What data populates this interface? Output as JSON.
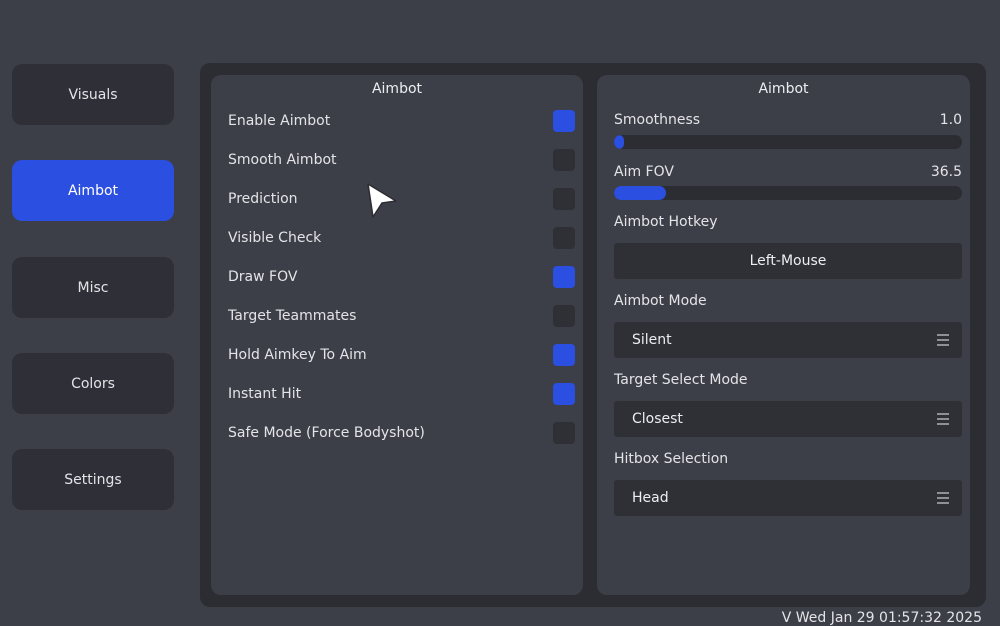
{
  "sidebar": {
    "items": [
      {
        "label": "Visuals",
        "active": false
      },
      {
        "label": "Aimbot",
        "active": true
      },
      {
        "label": "Misc",
        "active": false
      },
      {
        "label": "Colors",
        "active": false
      },
      {
        "label": "Settings",
        "active": false
      }
    ]
  },
  "left_panel": {
    "title": "Aimbot",
    "options": [
      {
        "label": "Enable Aimbot",
        "checked": true
      },
      {
        "label": "Smooth Aimbot",
        "checked": false
      },
      {
        "label": "Prediction",
        "checked": false
      },
      {
        "label": "Visible Check",
        "checked": false
      },
      {
        "label": "Draw FOV",
        "checked": true
      },
      {
        "label": "Target Teammates",
        "checked": false
      },
      {
        "label": "Hold Aimkey To Aim",
        "checked": true
      },
      {
        "label": "Instant Hit",
        "checked": true
      },
      {
        "label": "Safe Mode (Force Bodyshot)",
        "checked": false
      }
    ]
  },
  "right_panel": {
    "title": "Aimbot",
    "smoothness": {
      "label": "Smoothness",
      "value": "1.0",
      "fill_fraction": 0.03
    },
    "aim_fov": {
      "label": "Aim FOV",
      "value": "36.5",
      "fill_fraction": 0.15
    },
    "hotkey": {
      "label": "Aimbot Hotkey",
      "value": "Left-Mouse"
    },
    "aimbot_mode": {
      "label": "Aimbot Mode",
      "value": "Silent"
    },
    "target_select_mode": {
      "label": "Target Select Mode",
      "value": "Closest"
    },
    "hitbox_selection": {
      "label": "Hitbox Selection",
      "value": "Head"
    }
  },
  "footer": {
    "text": "V Wed Jan 29 01:57:32 2025"
  },
  "colors": {
    "accent": "#2b4fe0",
    "background": "#3d3f48",
    "frame": "#2c2d33",
    "control": "#2f3036"
  }
}
